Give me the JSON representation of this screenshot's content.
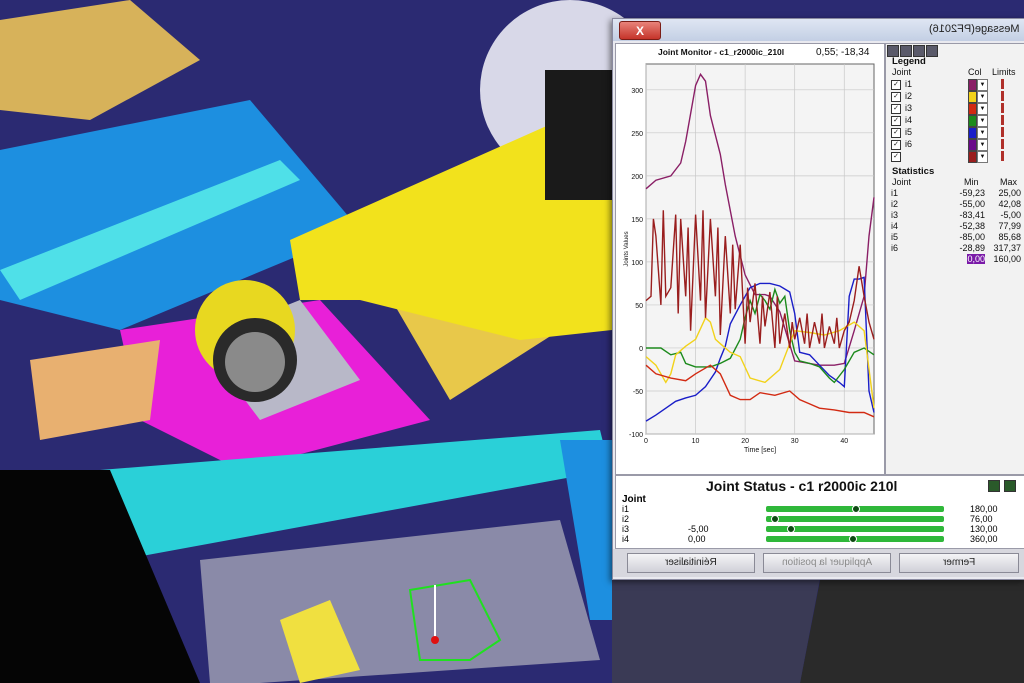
{
  "window": {
    "title": "Message(PF2016)",
    "close_label": "X"
  },
  "plot": {
    "title": "Joint Monitor - c1_r2000ic_210l",
    "coord_readout": "0,55; -18,34"
  },
  "legend": {
    "heading": "Legend",
    "col_joint": "Joint",
    "col_col": "Col",
    "col_limits": "Limits",
    "rows": [
      {
        "label": "i1",
        "checked": true,
        "color": "#8a1f66"
      },
      {
        "label": "i2",
        "checked": true,
        "color": "#f2d21a"
      },
      {
        "label": "i3",
        "checked": true,
        "color": "#d22a12"
      },
      {
        "label": "i4",
        "checked": true,
        "color": "#1c8a1c"
      },
      {
        "label": "i5",
        "checked": true,
        "color": "#1a1ec8"
      },
      {
        "label": "i6",
        "checked": true,
        "color": "#6a0a8a"
      },
      {
        "label": "",
        "checked": true,
        "color": "#9a1e1e"
      }
    ]
  },
  "statistics": {
    "heading": "Statistics",
    "col_joint": "Joint",
    "col_min": "Min",
    "col_max": "Max",
    "rows": [
      {
        "name": "i1",
        "min": "-59,23",
        "max": "25,00"
      },
      {
        "name": "i2",
        "min": "-55,00",
        "max": "42,08"
      },
      {
        "name": "i3",
        "min": "-83,41",
        "max": "-5,00"
      },
      {
        "name": "i4",
        "min": "-52,38",
        "max": "77,99"
      },
      {
        "name": "i5",
        "min": "-85,00",
        "max": "85,68"
      },
      {
        "name": "i6",
        "min": "-28,89",
        "max": "317,37"
      },
      {
        "name": "",
        "min": "0,00",
        "max": "160,00"
      }
    ]
  },
  "joint_status": {
    "title": "Joint Status - c1  r2000ic  210l",
    "joint_label": "Joint",
    "rows": [
      {
        "name": "i1",
        "left": "",
        "right": "180,00",
        "pos": 0.5
      },
      {
        "name": "i2",
        "left": "",
        "right": "76,00",
        "pos": 0.03
      },
      {
        "name": "i3",
        "left": "-5,00",
        "right": "130,00",
        "pos": 0.12
      },
      {
        "name": "i4",
        "left": "0,00",
        "right": "360,00",
        "pos": 0.48
      }
    ]
  },
  "buttons": {
    "reset": "Réinitialiser",
    "apply": "Appliquer la position",
    "close": "Fermer"
  },
  "chart_data": {
    "type": "line",
    "xlabel": "Time [sec]",
    "ylabel": "Joints Values",
    "xlim": [
      0,
      46
    ],
    "ylim": [
      -100,
      330
    ],
    "xticks": [
      0,
      10,
      20,
      30,
      40
    ],
    "yticks": [
      -100,
      -50,
      0,
      50,
      100,
      150,
      200,
      250,
      300
    ],
    "grid": true,
    "series": [
      {
        "color": "#8a1f66",
        "x": [
          0,
          2,
          5,
          7,
          8,
          10,
          11,
          12,
          13,
          15,
          16,
          18,
          20,
          22,
          24,
          25,
          27,
          30,
          35,
          38,
          40,
          42,
          44,
          45,
          46
        ],
        "y": [
          185,
          195,
          200,
          215,
          240,
          305,
          318,
          310,
          270,
          225,
          190,
          130,
          85,
          62,
          62,
          60,
          42,
          -15,
          -20,
          -20,
          -18,
          20,
          60,
          130,
          175
        ]
      },
      {
        "color": "#1a1ec8",
        "x": [
          0,
          2,
          4,
          6,
          8,
          10,
          12,
          14,
          15,
          16,
          17,
          19,
          21,
          23,
          25,
          27,
          29,
          30,
          31,
          33,
          35,
          37,
          39,
          40,
          41,
          42,
          43,
          44,
          45,
          46
        ],
        "y": [
          -85,
          -78,
          -70,
          -62,
          -58,
          -55,
          -45,
          -28,
          -12,
          2,
          28,
          50,
          70,
          75,
          75,
          72,
          65,
          40,
          -5,
          -8,
          -20,
          -32,
          -40,
          -45,
          60,
          80,
          80,
          82,
          -50,
          -75
        ]
      },
      {
        "color": "#1c8a1c",
        "x": [
          0,
          3,
          5,
          7,
          8,
          10,
          13,
          15,
          17,
          19,
          20,
          21,
          22,
          23,
          24,
          25,
          26,
          27,
          28,
          29,
          30,
          31,
          33,
          35,
          37,
          38,
          40,
          42,
          44,
          46
        ],
        "y": [
          0,
          0,
          -8,
          -5,
          -18,
          -22,
          -22,
          -18,
          -12,
          10,
          35,
          55,
          40,
          62,
          55,
          45,
          68,
          52,
          60,
          20,
          -5,
          -15,
          -18,
          -22,
          -35,
          -40,
          -25,
          -5,
          0,
          -8
        ]
      },
      {
        "color": "#f2d21a",
        "x": [
          0,
          2,
          4,
          5,
          6,
          8,
          10,
          12,
          13,
          14,
          15,
          17,
          19,
          21,
          24,
          27,
          30,
          33,
          36,
          39,
          42,
          44,
          46
        ],
        "y": [
          -10,
          -20,
          -40,
          -30,
          -8,
          2,
          10,
          35,
          30,
          10,
          5,
          -5,
          -10,
          -35,
          -40,
          -25,
          20,
          18,
          15,
          20,
          30,
          20,
          -70
        ]
      },
      {
        "color": "#d22a12",
        "x": [
          0,
          2,
          5,
          8,
          10,
          13,
          15,
          17,
          19,
          21,
          23,
          26,
          29,
          31,
          33,
          35,
          38,
          41,
          44,
          46
        ],
        "y": [
          -20,
          -30,
          -35,
          -38,
          -30,
          -20,
          -30,
          -55,
          -60,
          -60,
          -52,
          -55,
          -50,
          -60,
          -65,
          -70,
          -72,
          -75,
          -75,
          -80
        ]
      },
      {
        "color": "#9a1e1e",
        "x": [
          0,
          1,
          1.5,
          2,
          3,
          3.5,
          4,
          5,
          6,
          6.5,
          7,
          8,
          8.5,
          9,
          10,
          11,
          11.5,
          12,
          13,
          14,
          14.5,
          15,
          16,
          17,
          17.5,
          18,
          19,
          20,
          20.5,
          21,
          22,
          23,
          23.5,
          24,
          25,
          26,
          26.5,
          27,
          28,
          29,
          29.5,
          30,
          31,
          32,
          32.5,
          33,
          34,
          35,
          35.5,
          36,
          37,
          38,
          38.5,
          39,
          40,
          41,
          42,
          43,
          44,
          45,
          46
        ],
        "y": [
          55,
          60,
          150,
          130,
          50,
          160,
          60,
          70,
          155,
          40,
          150,
          60,
          140,
          20,
          155,
          55,
          160,
          35,
          150,
          60,
          140,
          15,
          130,
          40,
          120,
          45,
          120,
          5,
          70,
          30,
          75,
          5,
          60,
          25,
          65,
          0,
          60,
          5,
          40,
          0,
          30,
          10,
          35,
          5,
          40,
          0,
          30,
          5,
          40,
          0,
          25,
          5,
          35,
          0,
          20,
          30,
          55,
          95,
          60,
          30,
          10
        ]
      }
    ]
  }
}
